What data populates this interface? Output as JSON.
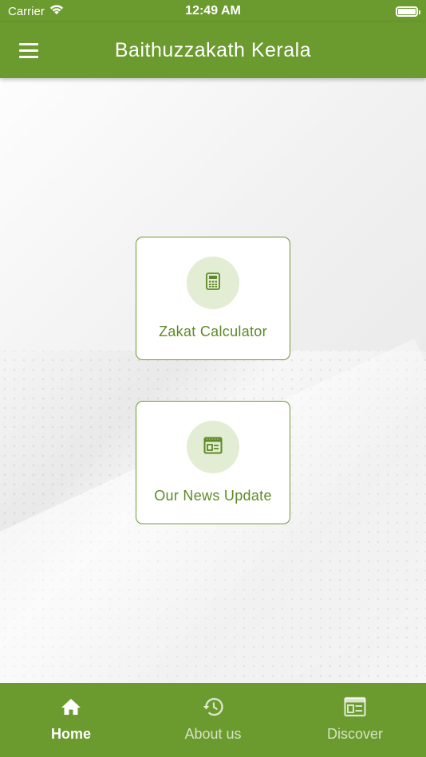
{
  "status_bar": {
    "carrier": "Carrier",
    "time": "12:49 AM",
    "wifi_icon": "wifi-icon",
    "battery_icon": "battery-icon"
  },
  "app_bar": {
    "title": "Baithuzzakath Kerala",
    "menu_icon": "hamburger-menu-icon"
  },
  "cards": [
    {
      "label": "Zakat Calculator",
      "icon": "calculator-icon"
    },
    {
      "label": "Our News Update",
      "icon": "news-icon"
    }
  ],
  "bottom_nav": {
    "items": [
      {
        "label": "Home",
        "icon": "home-icon",
        "active": true
      },
      {
        "label": "About us",
        "icon": "history-icon",
        "active": false
      },
      {
        "label": "Discover",
        "icon": "discover-icon",
        "active": false
      }
    ]
  },
  "colors": {
    "primary": "#6b9a2e",
    "accent_text": "#5d8a26",
    "icon_circle": "#e3edd3"
  }
}
